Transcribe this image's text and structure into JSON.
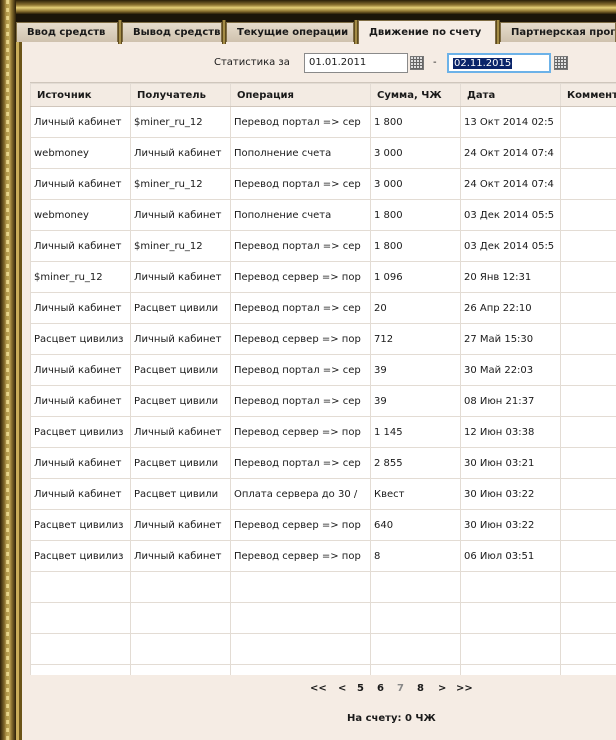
{
  "tabs": [
    {
      "label": "Ввод средств"
    },
    {
      "label": "Вывод средств"
    },
    {
      "label": "Текущие операции"
    },
    {
      "label": "Движение по счету",
      "active": true
    },
    {
      "label": "Партнерская прогр"
    }
  ],
  "filter": {
    "label": "Статистика за",
    "date_from": "01.01.2011",
    "separator": "-",
    "date_to": "02.11.2015"
  },
  "table": {
    "headers": [
      "Источник",
      "Получатель",
      "Операция",
      "Сумма, ЧЖ",
      "Дата",
      "Коммент"
    ],
    "rows": [
      [
        "Личный кабинет",
        "$miner_ru_12",
        "Перевод портал => сер",
        "1 800",
        "13 Окт 2014 02:5",
        ""
      ],
      [
        "webmoney",
        "Личный кабинет",
        "Пополнение счета",
        "3 000",
        "24 Окт 2014 07:4",
        ""
      ],
      [
        "Личный кабинет",
        "$miner_ru_12",
        "Перевод портал => сер",
        "3 000",
        "24 Окт 2014 07:4",
        ""
      ],
      [
        "webmoney",
        "Личный кабинет",
        "Пополнение счета",
        "1 800",
        "03 Дек 2014 05:5",
        ""
      ],
      [
        "Личный кабинет",
        "$miner_ru_12",
        "Перевод портал => сер",
        "1 800",
        "03 Дек 2014 05:5",
        ""
      ],
      [
        "$miner_ru_12",
        "Личный кабинет",
        "Перевод сервер => пор",
        "1 096",
        "20 Янв 12:31",
        ""
      ],
      [
        "Личный кабинет",
        "Расцвет цивили",
        "Перевод портал => сер",
        "20",
        "26 Апр 22:10",
        ""
      ],
      [
        "Расцвет цивилиз",
        "Личный кабинет",
        "Перевод сервер => пор",
        "712",
        "27 Май 15:30",
        ""
      ],
      [
        "Личный кабинет",
        "Расцвет цивили",
        "Перевод портал => сер",
        "39",
        "30 Май 22:03",
        ""
      ],
      [
        "Личный кабинет",
        "Расцвет цивили",
        "Перевод портал => сер",
        "39",
        "08 Июн 21:37",
        ""
      ],
      [
        "Расцвет цивилиз",
        "Личный кабинет",
        "Перевод сервер => пор",
        "1 145",
        "12 Июн 03:38",
        ""
      ],
      [
        "Личный кабинет",
        "Расцвет цивили",
        "Перевод портал => сер",
        "2 855",
        "30 Июн 03:21",
        ""
      ],
      [
        "Личный кабинет",
        "Расцвет цивили",
        "Оплата сервера до 30 /",
        "Квест",
        "30 Июн 03:22",
        ""
      ],
      [
        "Расцвет цивилиз",
        "Личный кабинет",
        "Перевод сервер => пор",
        "640",
        "30 Июн 03:22",
        ""
      ],
      [
        "Расцвет цивилиз",
        "Личный кабинет",
        "Перевод сервер => пор",
        "8",
        "06 Июл 03:51",
        ""
      ],
      [
        "",
        "",
        "",
        "",
        "",
        ""
      ],
      [
        "",
        "",
        "",
        "",
        "",
        ""
      ],
      [
        "",
        "",
        "",
        "",
        "",
        ""
      ],
      [
        "",
        "",
        "",
        "",
        "",
        ""
      ]
    ]
  },
  "pager": {
    "first": "<<",
    "prev": "<",
    "pages": [
      "5",
      "6",
      "7",
      "8"
    ],
    "current": "7",
    "next": ">",
    "last": ">>"
  },
  "balance": "На счету: 0 ЧЖ"
}
